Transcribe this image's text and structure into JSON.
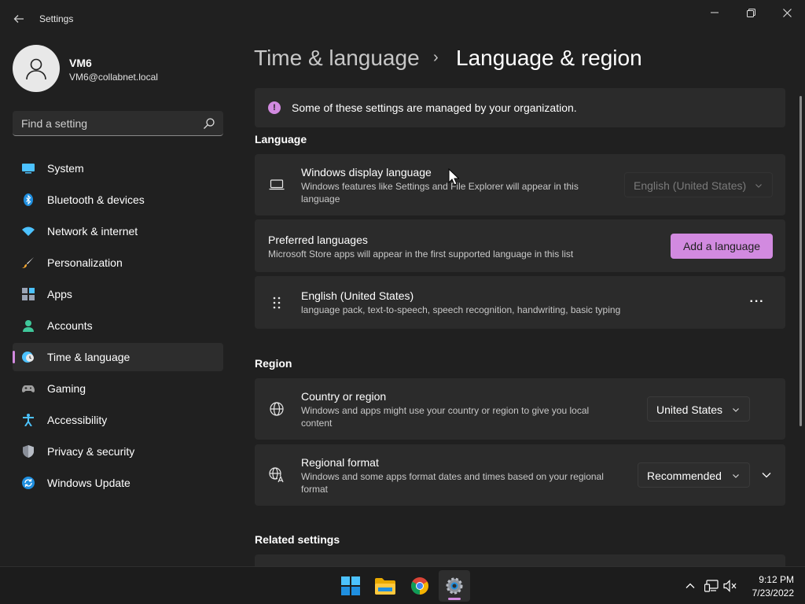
{
  "window": {
    "title": "Settings",
    "back_icon": "arrow-left-icon",
    "minimize_icon": "minimize-icon",
    "maximize_icon": "restore-icon",
    "close_icon": "close-icon"
  },
  "user": {
    "name": "VM6",
    "email": "VM6@collabnet.local",
    "avatar_icon": "person-icon"
  },
  "search": {
    "placeholder": "Find a setting",
    "icon": "search-icon"
  },
  "sidebar": {
    "items": [
      {
        "label": "System",
        "icon": "monitor-icon",
        "active": false
      },
      {
        "label": "Bluetooth & devices",
        "icon": "bluetooth-icon",
        "active": false
      },
      {
        "label": "Network & internet",
        "icon": "wifi-icon",
        "active": false
      },
      {
        "label": "Personalization",
        "icon": "brush-icon",
        "active": false
      },
      {
        "label": "Apps",
        "icon": "apps-icon",
        "active": false
      },
      {
        "label": "Accounts",
        "icon": "account-icon",
        "active": false
      },
      {
        "label": "Time & language",
        "icon": "clock-globe-icon",
        "active": true
      },
      {
        "label": "Gaming",
        "icon": "gamepad-icon",
        "active": false
      },
      {
        "label": "Accessibility",
        "icon": "accessibility-icon",
        "active": false
      },
      {
        "label": "Privacy & security",
        "icon": "shield-icon",
        "active": false
      },
      {
        "label": "Windows Update",
        "icon": "update-icon",
        "active": false
      }
    ]
  },
  "header": {
    "parent": "Time & language",
    "separator": "›",
    "current": "Language & region"
  },
  "notice": {
    "icon": "info-icon",
    "text": "Some of these settings are managed by your organization."
  },
  "language_section": {
    "title": "Language",
    "display_language": {
      "title": "Windows display language",
      "description": "Windows features like Settings and File Explorer will appear in this language",
      "value": "English (United States)",
      "disabled": true
    },
    "preferred": {
      "title": "Preferred languages",
      "description": "Microsoft Store apps will appear in the first supported language in this list",
      "add_button": "Add a language"
    },
    "installed": [
      {
        "title": "English (United States)",
        "description": "language pack, text-to-speech, speech recognition, handwriting, basic typing",
        "more_label": "···"
      }
    ]
  },
  "region_section": {
    "title": "Region",
    "country": {
      "title": "Country or region",
      "description": "Windows and apps might use your country or region to give you local content",
      "value": "United States"
    },
    "format": {
      "title": "Regional format",
      "description": "Windows and some apps format dates and times based on your regional format",
      "value": "Recommended"
    }
  },
  "related": {
    "title": "Related settings"
  },
  "taskbar": {
    "apps": [
      {
        "name": "start",
        "icon": "windows-start-icon"
      },
      {
        "name": "file-explorer",
        "icon": "folder-icon"
      },
      {
        "name": "chrome",
        "icon": "chrome-icon"
      },
      {
        "name": "settings",
        "icon": "gear-icon",
        "active": true
      }
    ],
    "tray": {
      "chevron_icon": "chevron-up-icon",
      "network_icon": "network-icon",
      "volume_icon": "volume-muted-icon"
    },
    "clock": {
      "time": "9:12 PM",
      "date": "7/23/2022"
    }
  },
  "colors": {
    "accent": "#d28ae0",
    "background": "#202020",
    "card": "#2b2b2b"
  }
}
